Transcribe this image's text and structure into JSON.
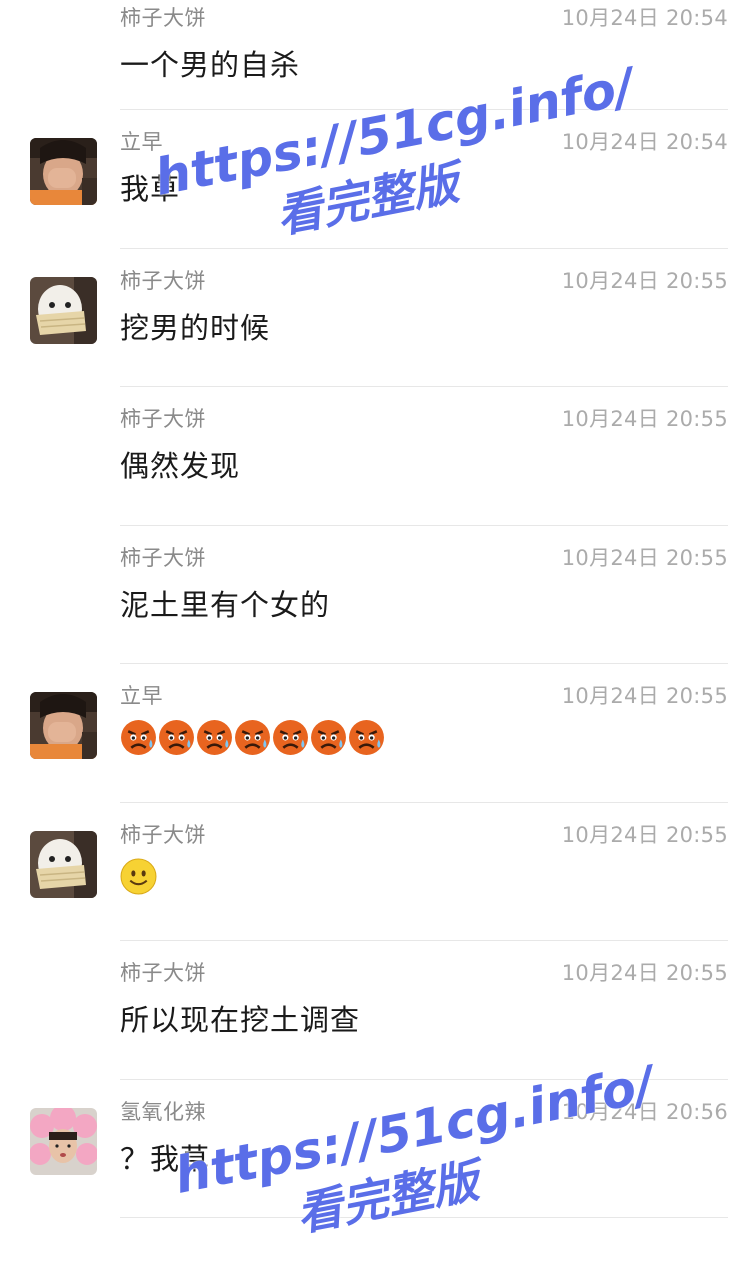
{
  "messages": [
    {
      "sender": "柿子大饼",
      "time": "10月24日 20:54",
      "text": "一个男的自杀",
      "avatar": "none"
    },
    {
      "sender": "立早",
      "time": "10月24日 20:54",
      "text": "我草",
      "avatar": "person-covering-face"
    },
    {
      "sender": "柿子大饼",
      "time": "10月24日 20:55",
      "text": "挖男的时候",
      "avatar": "dog-with-mask"
    },
    {
      "sender": "柿子大饼",
      "time": "10月24日 20:55",
      "text": "偶然发现",
      "avatar": "none"
    },
    {
      "sender": "柿子大饼",
      "time": "10月24日 20:55",
      "text": "泥土里有个女的",
      "avatar": "none"
    },
    {
      "sender": "立早",
      "time": "10月24日 20:55",
      "text": "",
      "avatar": "person-covering-face",
      "emojis": [
        "angry-sweat-emoji",
        "angry-sweat-emoji",
        "angry-sweat-emoji",
        "angry-sweat-emoji",
        "angry-sweat-emoji",
        "angry-sweat-emoji",
        "angry-sweat-emoji"
      ]
    },
    {
      "sender": "柿子大饼",
      "time": "10月24日 20:55",
      "text": "",
      "avatar": "dog-with-mask",
      "emojis": [
        "smile-emoji"
      ]
    },
    {
      "sender": "柿子大饼",
      "time": "10月24日 20:55",
      "text": "所以现在挖土调查",
      "avatar": "none"
    },
    {
      "sender": "氢氧化辣",
      "time": "10月24日 20:56",
      "text": "？我草",
      "avatar": "person-pink-hat"
    }
  ],
  "watermarks": [
    {
      "url": "https://51cg.info/",
      "sub": "看完整版"
    },
    {
      "url": "https://51cg.info/",
      "sub": "看完整版"
    }
  ],
  "colors": {
    "sender": "#8a8a8a",
    "time": "#ababab",
    "text": "#1a1a1a",
    "divider": "#e7e7e7",
    "watermark": "#5a6ee8"
  }
}
